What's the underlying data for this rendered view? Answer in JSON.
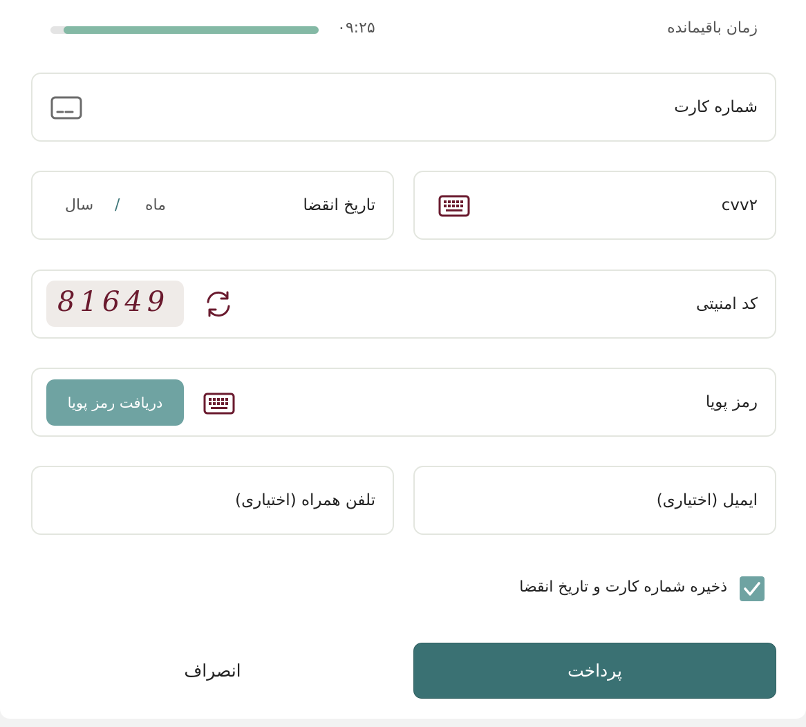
{
  "timer": {
    "label": "زمان باقیمانده",
    "value": "۰۹:۲۵",
    "progress": 0.95
  },
  "fields": {
    "card_number": {
      "label": "شماره کارت",
      "icon": "card-icon"
    },
    "cvv2": {
      "label": "cvv۲",
      "icon": "keyboard-icon"
    },
    "expiry": {
      "label": "تاریخ انقضا",
      "month_placeholder": "ماه",
      "separator": "/",
      "year_placeholder": "سال"
    },
    "captcha": {
      "label": "کد امنیتی",
      "code": "81649",
      "refresh_icon": "refresh-icon"
    },
    "otp": {
      "label": "رمز پویا",
      "button_label": "دریافت رمز پویا",
      "icon": "keyboard-icon"
    },
    "email": {
      "label": "ایمیل (اختیاری)"
    },
    "phone": {
      "label": "تلفن همراه (اختیاری)"
    }
  },
  "save_card": {
    "label": "ذخیره شماره کارت و تاریخ انقضا",
    "checked": true
  },
  "actions": {
    "pay_label": "پرداخت",
    "cancel_label": "انصراف"
  },
  "colors": {
    "primary": "#3a7173",
    "accent": "#6fa3a2",
    "progress": "#84b9a5",
    "icon_dark_red": "#6a1a2e",
    "border": "#e3e6df"
  }
}
